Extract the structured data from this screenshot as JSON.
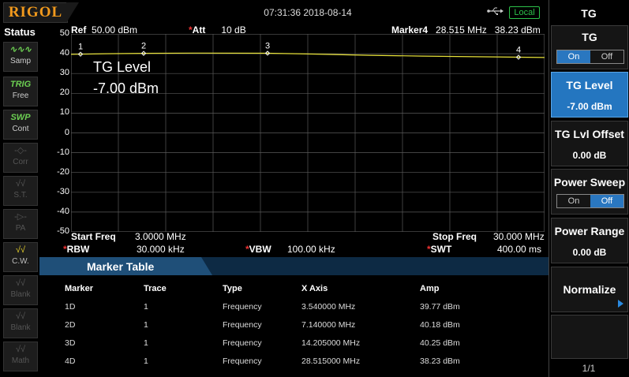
{
  "header": {
    "logo": "RIGOL",
    "datetime": "07:31:36 2018-08-14",
    "remote_status": "Local"
  },
  "status_panel": {
    "title": "Status",
    "buttons": [
      {
        "icon": "samp-wave-icon",
        "glyph": "∿∿∿",
        "label": "Samp",
        "state": "on"
      },
      {
        "icon": "trig-icon",
        "glyph": "TRIG",
        "label": "Free",
        "state": "on"
      },
      {
        "icon": "swp-icon",
        "glyph": "SWP",
        "label": "Cont",
        "state": "on"
      },
      {
        "icon": "corr-icon",
        "glyph": "-◇-",
        "label": "Corr",
        "state": "off"
      },
      {
        "icon": "st-icon",
        "glyph": "√√",
        "label": "S.T.",
        "state": "off"
      },
      {
        "icon": "pa-icon",
        "glyph": "-▷-",
        "label": "PA",
        "state": "off"
      },
      {
        "icon": "cw-icon",
        "glyph": "√√",
        "label": "C.W.",
        "state": "cw"
      },
      {
        "icon": "blank-icon",
        "glyph": "√√",
        "label": "Blank",
        "state": "off"
      },
      {
        "icon": "blank-icon",
        "glyph": "√√",
        "label": "Blank",
        "state": "off"
      },
      {
        "icon": "math-icon",
        "glyph": "√√",
        "label": "Math",
        "state": "off"
      }
    ]
  },
  "graph": {
    "ref": "Ref",
    "ref_value": "50.00 dBm",
    "att": "Att",
    "att_value": "10 dB",
    "marker_name": "Marker4",
    "marker_freq": "28.515 MHz",
    "marker_amp": "38.23 dBm",
    "tg_label": "TG Level",
    "tg_value": "-7.00 dBm",
    "start_label": "Start Freq",
    "start_value": "3.0000 MHz",
    "stop_label": "Stop Freq",
    "stop_value": "30.000 MHz",
    "rbw_label": "RBW",
    "rbw_value": "30.000 kHz",
    "vbw_label": "VBW",
    "vbw_value": "100.00 kHz",
    "swt_label": "SWT",
    "swt_value": "400.00 ms"
  },
  "chart_data": {
    "type": "line",
    "x_unit": "MHz",
    "xlim": [
      3.0,
      30.0
    ],
    "ylim": [
      -50,
      50
    ],
    "y_ticks": [
      "50",
      "40",
      "30",
      "20",
      "10",
      "0",
      "-10",
      "-20",
      "-30",
      "-40",
      "-50"
    ],
    "grid": true,
    "trace_color": "#e8e23a",
    "series": [
      {
        "x": [
          3.0,
          3.54,
          5.0,
          7.14,
          10.0,
          14.205,
          17.0,
          20.0,
          23.0,
          26.0,
          28.515,
          30.0
        ],
        "y": [
          39.7,
          39.77,
          40.0,
          40.18,
          40.3,
          40.25,
          39.8,
          39.2,
          38.8,
          38.5,
          38.23,
          38.1
        ]
      }
    ],
    "markers": [
      {
        "label": "1",
        "x": 3.54,
        "y": 39.77
      },
      {
        "label": "2",
        "x": 7.14,
        "y": 40.18
      },
      {
        "label": "3",
        "x": 14.205,
        "y": 40.25
      },
      {
        "label": "4",
        "x": 28.515,
        "y": 38.23
      }
    ]
  },
  "marker_table": {
    "title": "Marker Table",
    "columns": [
      "Marker",
      "Trace",
      "Type",
      "X Axis",
      "Amp"
    ],
    "rows": [
      [
        "1D",
        "1",
        "Frequency",
        "3.540000 MHz",
        "39.77 dBm"
      ],
      [
        "2D",
        "1",
        "Frequency",
        "7.140000 MHz",
        "40.18 dBm"
      ],
      [
        "3D",
        "1",
        "Frequency",
        "14.205000 MHz",
        "40.25 dBm"
      ],
      [
        "4D",
        "1",
        "Frequency",
        "28.515000 MHz",
        "38.23 dBm"
      ]
    ]
  },
  "menu": {
    "title": "TG",
    "tg": {
      "label": "TG",
      "on": "On",
      "off": "Off"
    },
    "tg_level": {
      "label": "TG Level",
      "value": "-7.00 dBm"
    },
    "tg_offset": {
      "label": "TG Lvl Offset",
      "value": "0.00 dB"
    },
    "power_sweep": {
      "label": "Power Sweep",
      "on": "On",
      "off": "Off"
    },
    "power_range": {
      "label": "Power Range",
      "value": "0.00 dB"
    },
    "normalize": {
      "label": "Normalize"
    },
    "page": "1/1"
  },
  "colors": {
    "trace": "#e8e23a",
    "grid": "#5a5a5a",
    "accent": "#2476c0",
    "brand": "#f29a1d",
    "local": "#2cc24a"
  }
}
